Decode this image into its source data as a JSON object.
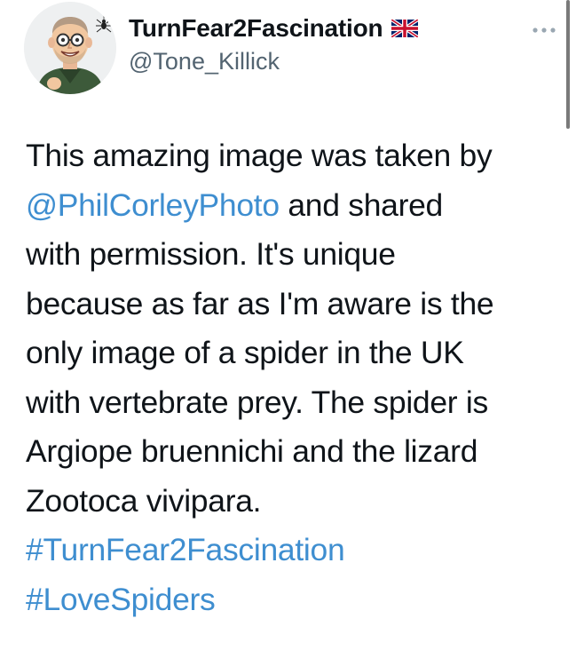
{
  "author": {
    "display_name": "TurnFear2Fascination",
    "handle": "@Tone_Killick",
    "flag_icon": "uk-flag-icon",
    "avatar_icon": "cartoon-avatar-with-spider"
  },
  "header": {
    "more_icon": "more-options-icon"
  },
  "tweet": {
    "line1": "This amazing image was taken by",
    "mention": "@PhilCorleyPhoto",
    "line2_rest": " and shared",
    "line3": "with permission. It's unique",
    "line4": "because as far as I'm aware is the",
    "line5": "only image of a spider in the UK",
    "line6": "with vertebrate prey. The spider is",
    "line7": "Argiope bruennichi and the lizard",
    "line8": "Zootoca vivipara.",
    "hashtag1": "#TurnFear2Fascination",
    "hashtag2": "#LoveSpiders"
  },
  "colors": {
    "text": "#0f1419",
    "secondary": "#536471",
    "link": "#3e8ed0"
  }
}
